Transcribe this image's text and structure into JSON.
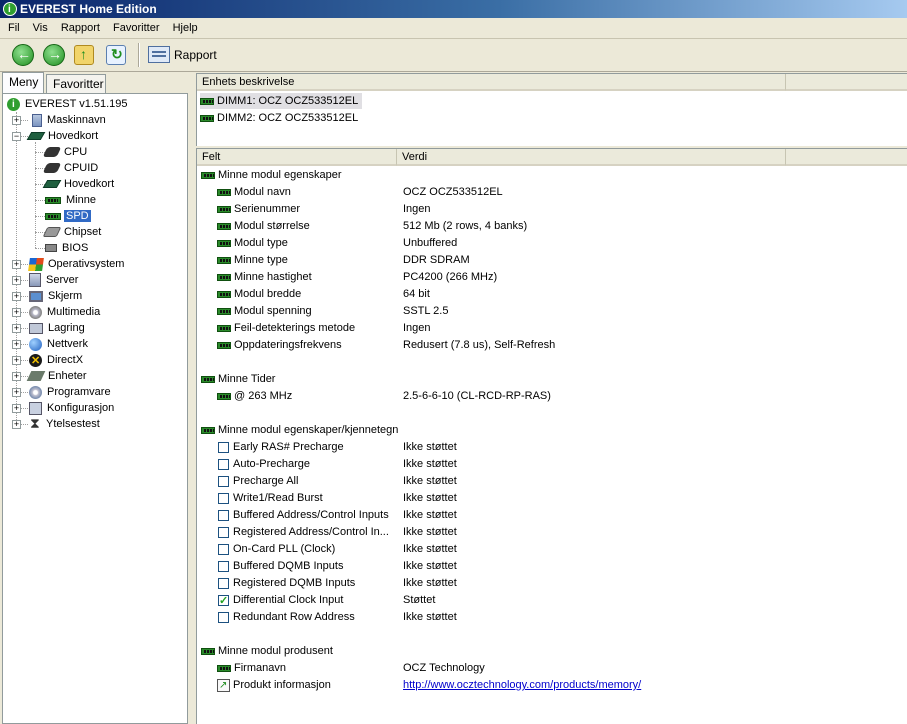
{
  "window": {
    "title": "EVEREST Home Edition"
  },
  "menu": [
    "Fil",
    "Vis",
    "Rapport",
    "Favoritter",
    "Hjelp"
  ],
  "toolbar": {
    "report_label": "Rapport"
  },
  "left_tabs": [
    {
      "label": "Meny",
      "active": true
    },
    {
      "label": "Favoritter",
      "active": false
    }
  ],
  "tree": {
    "root": "EVEREST v1.51.195",
    "items": [
      {
        "label": "Maskinnavn",
        "icon": "computer-icon"
      },
      {
        "label": "Hovedkort",
        "icon": "motherboard-icon",
        "expanded": true,
        "children": [
          "CPU",
          "CPUID",
          "Hovedkort",
          "Minne",
          "SPD",
          "Chipset",
          "BIOS"
        ]
      },
      {
        "label": "Operativsystem",
        "icon": "windows-icon"
      },
      {
        "label": "Server",
        "icon": "server-icon"
      },
      {
        "label": "Skjerm",
        "icon": "monitor-icon"
      },
      {
        "label": "Multimedia",
        "icon": "multimedia-icon"
      },
      {
        "label": "Lagring",
        "icon": "storage-icon"
      },
      {
        "label": "Nettverk",
        "icon": "network-icon"
      },
      {
        "label": "DirectX",
        "icon": "directx-icon"
      },
      {
        "label": "Enheter",
        "icon": "devices-icon"
      },
      {
        "label": "Programvare",
        "icon": "software-icon"
      },
      {
        "label": "Konfigurasjon",
        "icon": "configuration-icon"
      },
      {
        "label": "Ytelsestest",
        "icon": "hourglass-icon"
      }
    ],
    "selected": "SPD"
  },
  "devices": {
    "header": "Enhets beskrivelse",
    "rows": [
      "DIMM1: OCZ OCZ533512EL",
      "DIMM2: OCZ OCZ533512EL"
    ]
  },
  "details": {
    "headers": {
      "field": "Felt",
      "value": "Verdi"
    },
    "sections": [
      {
        "title": "Minne modul egenskaper",
        "rows": [
          {
            "field": "Modul navn",
            "value": "OCZ OCZ533512EL"
          },
          {
            "field": "Serienummer",
            "value": "Ingen"
          },
          {
            "field": "Modul størrelse",
            "value": "512 Mb (2 rows, 4 banks)"
          },
          {
            "field": "Modul type",
            "value": "Unbuffered"
          },
          {
            "field": "Minne type",
            "value": "DDR SDRAM"
          },
          {
            "field": "Minne hastighet",
            "value": "PC4200 (266 MHz)"
          },
          {
            "field": "Modul bredde",
            "value": "64 bit"
          },
          {
            "field": "Modul spenning",
            "value": "SSTL 2.5"
          },
          {
            "field": "Feil-detekterings metode",
            "value": "Ingen"
          },
          {
            "field": "Oppdateringsfrekvens",
            "value": "Redusert (7.8 us), Self-Refresh"
          }
        ]
      },
      {
        "title": "Minne Tider",
        "rows": [
          {
            "field": "@ 263 MHz",
            "value": "2.5-6-6-10  (CL-RCD-RP-RAS)"
          }
        ]
      },
      {
        "title": "Minne modul egenskaper/kjennetegn",
        "rows": [
          {
            "field": "Early RAS# Precharge",
            "value": "Ikke støttet",
            "checked": false
          },
          {
            "field": "Auto-Precharge",
            "value": "Ikke støttet",
            "checked": false
          },
          {
            "field": "Precharge All",
            "value": "Ikke støttet",
            "checked": false
          },
          {
            "field": "Write1/Read Burst",
            "value": "Ikke støttet",
            "checked": false
          },
          {
            "field": "Buffered Address/Control Inputs",
            "value": "Ikke støttet",
            "checked": false
          },
          {
            "field": "Registered Address/Control In...",
            "value": "Ikke støttet",
            "checked": false
          },
          {
            "field": "On-Card PLL (Clock)",
            "value": "Ikke støttet",
            "checked": false
          },
          {
            "field": "Buffered DQMB Inputs",
            "value": "Ikke støttet",
            "checked": false
          },
          {
            "field": "Registered DQMB Inputs",
            "value": "Ikke støttet",
            "checked": false
          },
          {
            "field": "Differential Clock Input",
            "value": "Støttet",
            "checked": true
          },
          {
            "field": "Redundant Row Address",
            "value": "Ikke støttet",
            "checked": false
          }
        ]
      },
      {
        "title": "Minne modul produsent",
        "rows": [
          {
            "field": "Firmanavn",
            "value": "OCZ Technology"
          },
          {
            "field": "Produkt informasjon",
            "value": "http://www.ocztechnology.com/products/memory/",
            "link": true
          }
        ]
      }
    ]
  }
}
